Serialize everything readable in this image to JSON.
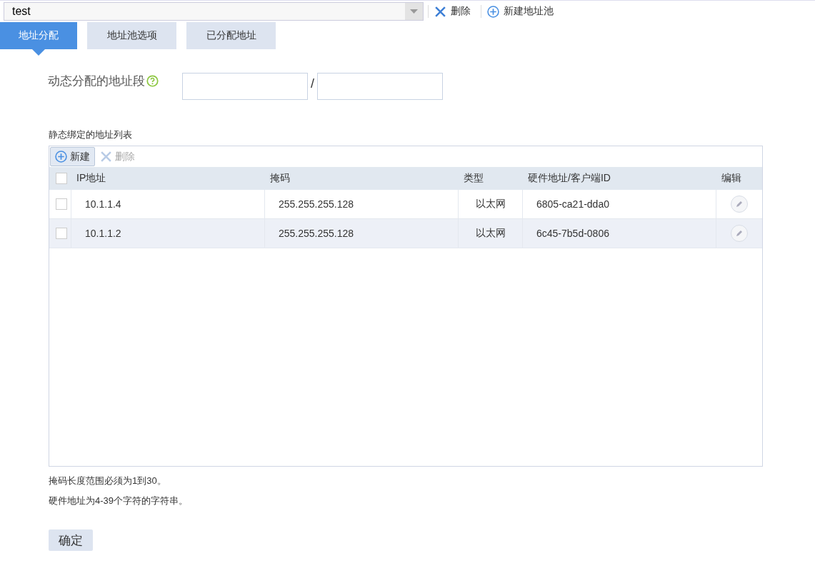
{
  "pool_select": {
    "value": "test"
  },
  "top_actions": [
    {
      "kind": "delete",
      "label": "删除"
    },
    {
      "kind": "add",
      "label": "新建地址池"
    }
  ],
  "tabs": [
    {
      "label": "地址分配",
      "selected": true
    },
    {
      "label": "地址池选项",
      "selected": false
    },
    {
      "label": "已分配地址",
      "selected": false
    }
  ],
  "dynamic_range": {
    "label": "动态分配的地址段",
    "separator": "/"
  },
  "static_list": {
    "title": "静态绑定的地址列表",
    "toolbar": [
      {
        "kind": "add",
        "label": "新建",
        "disabled": false
      },
      {
        "kind": "delete",
        "label": "删除",
        "disabled": true
      }
    ],
    "all_checked": false,
    "columns": [
      "IP地址",
      "掩码",
      "类型",
      "硬件地址/客户端ID",
      "编辑"
    ],
    "rows": [
      {
        "ip": "10.1.1.4",
        "mask": "255.255.255.128",
        "type": "以太网",
        "hw": "6805-ca21-dda0",
        "checked": false,
        "selected": false
      },
      {
        "ip": "10.1.1.2",
        "mask": "255.255.255.128",
        "type": "以太网",
        "hw": "6c45-7b5d-0806",
        "checked": false,
        "selected": true
      }
    ]
  },
  "notes": [
    "掩码长度范围必须为1到30。",
    "硬件地址为4-39个字符的字符串。"
  ],
  "confirm_button": "确定"
}
